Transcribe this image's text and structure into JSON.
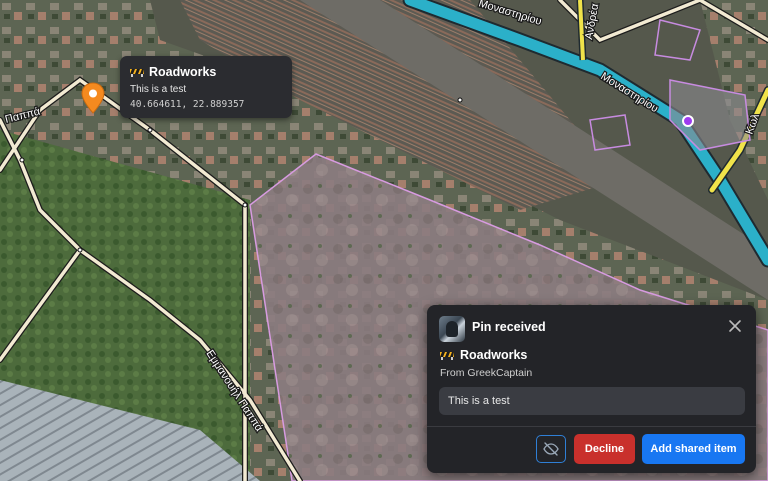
{
  "map": {
    "street_labels": [
      "Μοναστηρίου",
      "Μοναστηρίου",
      "Ανδρέα",
      "Κωλ",
      "Εμμανουήλ Παππά",
      "Παππά"
    ]
  },
  "pin_popup": {
    "title": "Roadworks",
    "description": "This is a test",
    "coordinates": "40.664611, 22.889357",
    "icon": "roadworks-barrier-icon"
  },
  "notification": {
    "heading": "Pin received",
    "item_name": "Roadworks",
    "item_icon": "roadworks-barrier-icon",
    "from_text": "From GreekCaptain",
    "message": "This is a test",
    "decline_label": "Decline",
    "add_label": "Add shared item",
    "hide_icon": "eye-off-icon",
    "close_icon": "close-icon"
  },
  "colors": {
    "pin": "#f58a1f",
    "zone_outline": "#d79be0",
    "road_main": "#2bb0c9",
    "road_secondary": "#f0e34a",
    "decline": "#c9302c",
    "accept": "#1877f2"
  }
}
